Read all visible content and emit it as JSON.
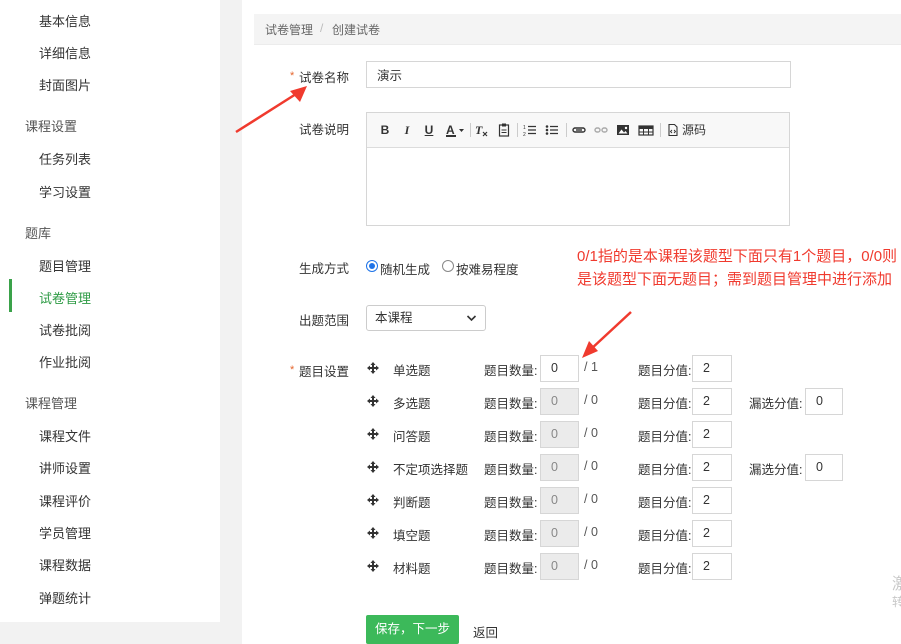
{
  "sidebar": {
    "items_top": [
      "基本信息",
      "详细信息",
      "封面图片"
    ],
    "group_course_settings": "课程设置",
    "items_settings": [
      "任务列表",
      "学习设置"
    ],
    "group_bank": "题库",
    "items_bank": [
      "题目管理",
      "试卷管理",
      "试卷批阅",
      "作业批阅"
    ],
    "group_course_mgmt": "课程管理",
    "items_mgmt": [
      "课程文件",
      "讲师设置",
      "课程评价",
      "学员管理",
      "课程数据",
      "弹题统计"
    ],
    "active": "试卷管理"
  },
  "breadcrumb": [
    "试卷管理",
    "创建试卷"
  ],
  "breadcrumb_sep": "/",
  "form": {
    "required_mark": "*",
    "name_label": "试卷名称",
    "name_value": "演示",
    "desc_label": "试卷说明",
    "source_label": "源码",
    "gen_label": "生成方式",
    "gen_options": [
      "随机生成",
      "按难易程度"
    ],
    "gen_selected": "随机生成",
    "range_label": "出题范围",
    "range_value": "本课程",
    "setup_label": "题目设置"
  },
  "questions": {
    "count_label": "题目数量:",
    "score_label": "题目分值:",
    "miss_label": "漏选分值:",
    "rows": [
      {
        "name": "单选题",
        "count": "0",
        "total": "/ 1",
        "score": "2",
        "enabled": true
      },
      {
        "name": "多选题",
        "count": "0",
        "total": "/ 0",
        "score": "2",
        "miss": "0",
        "enabled": false
      },
      {
        "name": "问答题",
        "count": "0",
        "total": "/ 0",
        "score": "2",
        "enabled": false
      },
      {
        "name": "不定项选择题",
        "count": "0",
        "total": "/ 0",
        "score": "2",
        "miss": "0",
        "enabled": false
      },
      {
        "name": "判断题",
        "count": "0",
        "total": "/ 0",
        "score": "2",
        "enabled": false
      },
      {
        "name": "填空题",
        "count": "0",
        "total": "/ 0",
        "score": "2",
        "enabled": false
      },
      {
        "name": "材料题",
        "count": "0",
        "total": "/ 0",
        "score": "2",
        "enabled": false
      }
    ]
  },
  "buttons": {
    "save": "保存，下一步",
    "back": "返回"
  },
  "annotation": "0/1指的是本课程该题型下面只有1个题目，0/0则是该题型下面无题目；需到题目管理中进行添加",
  "watermark": [
    "激",
    "转"
  ],
  "colors": {
    "accent_green": "#3cb95a",
    "annotation_red": "#f03a2e",
    "required_orange": "#e5652d",
    "radio_blue": "#1e73e8"
  }
}
